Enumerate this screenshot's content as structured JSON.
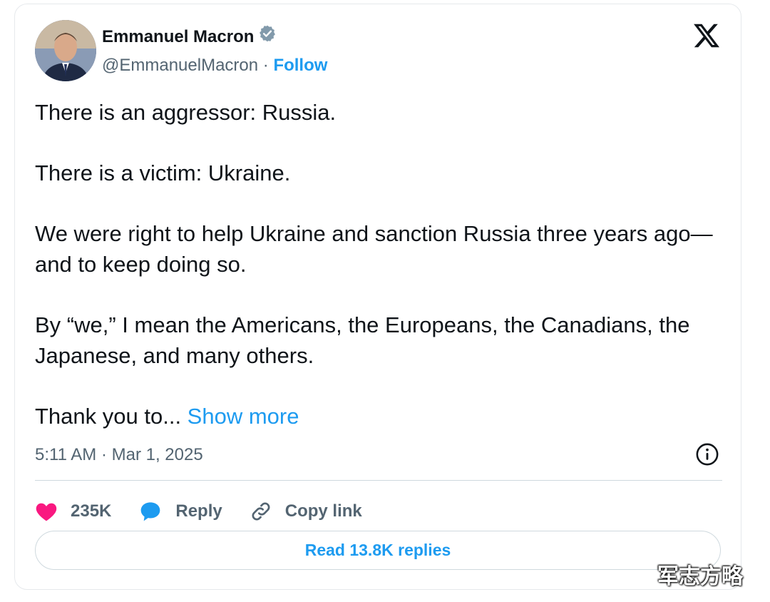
{
  "author": {
    "name": "Emmanuel Macron",
    "handle": "@EmmanuelMacron",
    "separator": " · ",
    "follow_label": "Follow",
    "verified_icon": "verified-badge-icon",
    "avatar_icon": "avatar"
  },
  "platform_icon": "x-logo-icon",
  "tweet": {
    "paragraphs": [
      "There is an aggressor: Russia.",
      "There is a victim: Ukraine.",
      "We were right to help Ukraine and sanction Russia three years ago—and to keep doing so.",
      "By “we,” I mean the Americans, the Europeans, the Canadians, the Japanese, and many others."
    ],
    "last_line": "Thank you to... ",
    "show_more_label": "Show more",
    "timestamp": "5:11 AM · Mar 1, 2025",
    "info_icon": "info-icon"
  },
  "actions": {
    "like_count": "235K",
    "like_icon": "heart-icon",
    "reply_label": "Reply",
    "reply_icon": "speech-bubble-icon",
    "copy_label": "Copy link",
    "copy_icon": "link-icon"
  },
  "read_replies_label": "Read 13.8K replies",
  "watermark": "军志方略",
  "colors": {
    "accent": "#1d9bf0",
    "text": "#0f1419",
    "muted": "#536471",
    "like": "#f91880",
    "border": "#cfd9de"
  }
}
